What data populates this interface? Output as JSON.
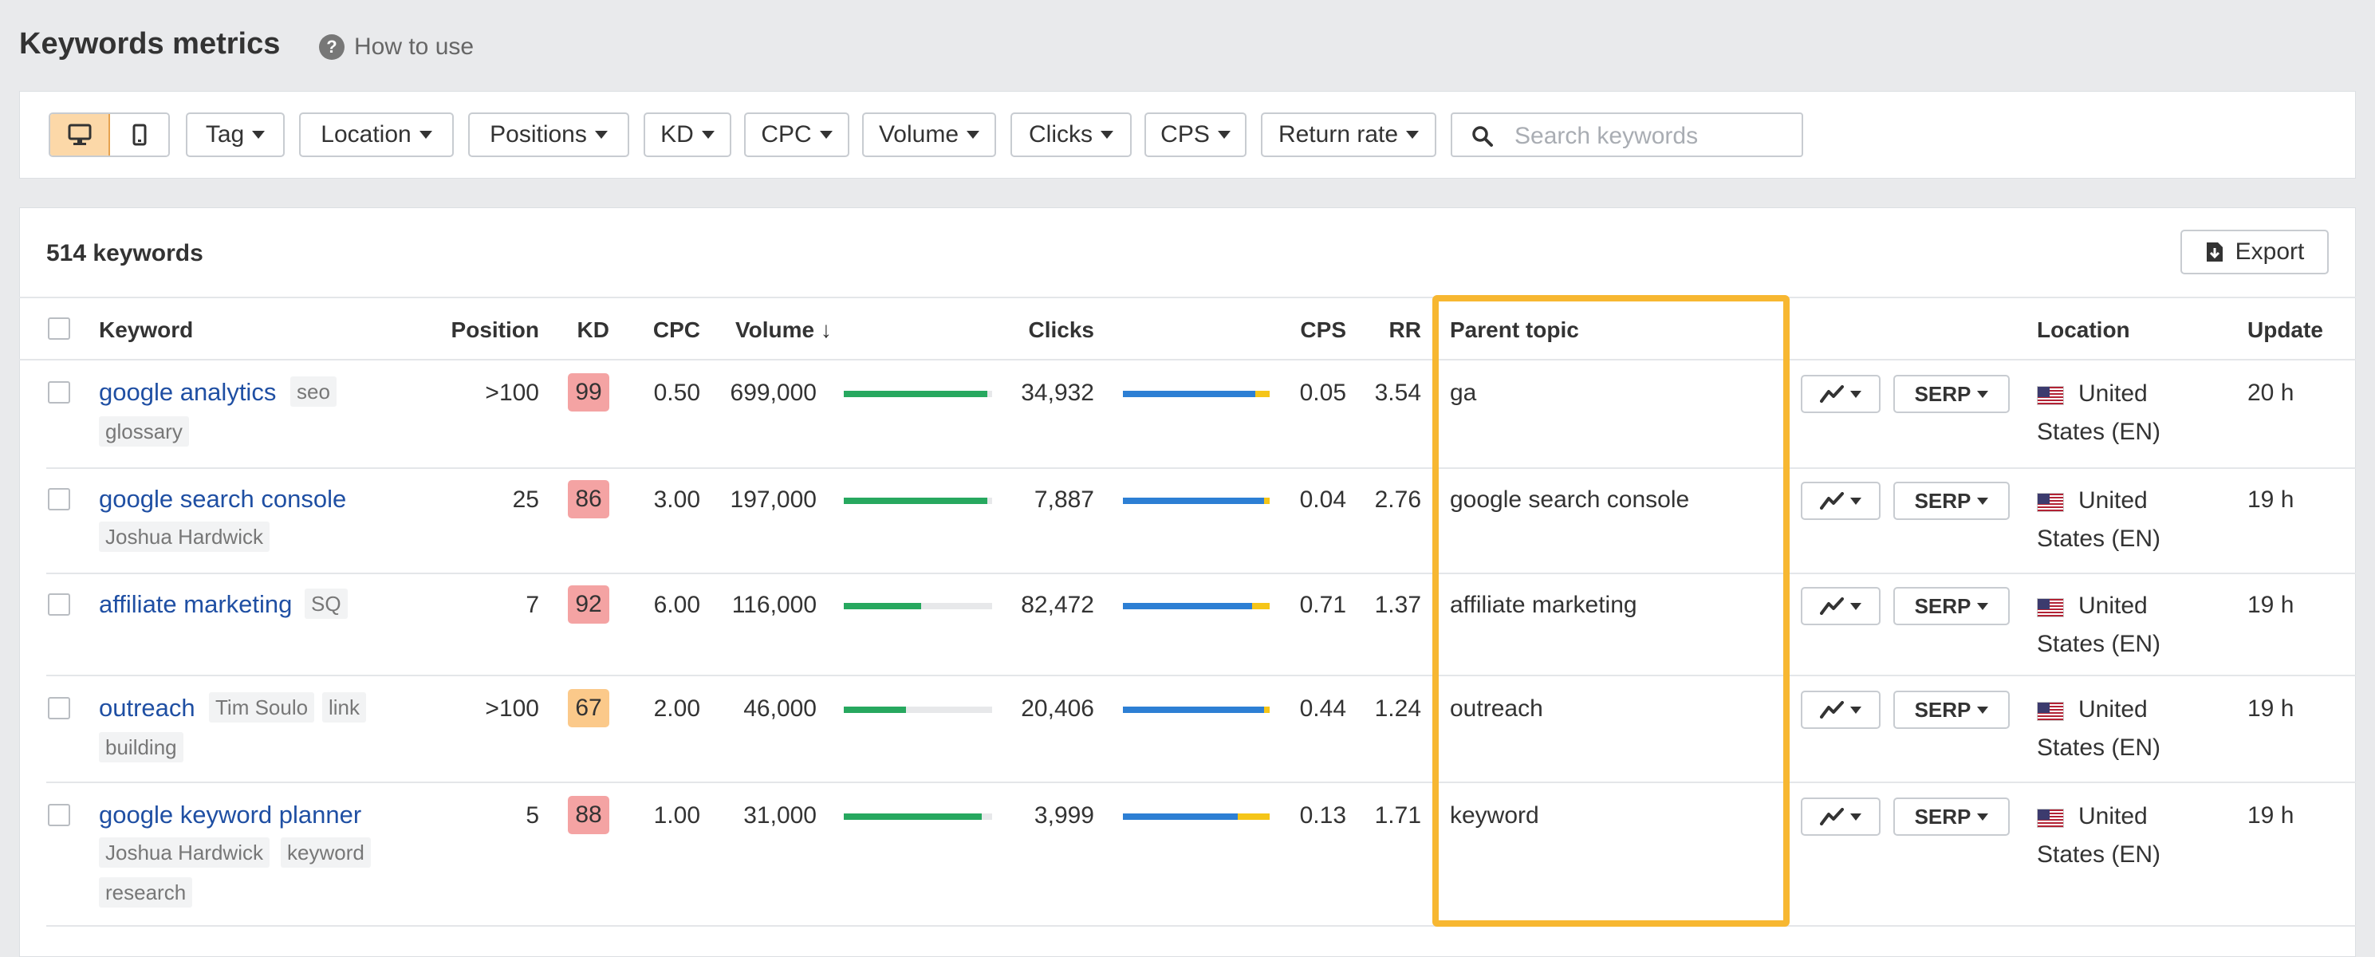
{
  "page_title": "Keywords metrics",
  "how_to_use": "How to use",
  "filters": {
    "tag": "Tag",
    "location": "Location",
    "positions": "Positions",
    "kd": "KD",
    "cpc": "CPC",
    "volume": "Volume",
    "clicks": "Clicks",
    "cps": "CPS",
    "return_rate": "Return rate",
    "search_placeholder": "Search keywords"
  },
  "summary": {
    "count_label": "514 keywords",
    "export_label": "Export"
  },
  "columns": {
    "keyword": "Keyword",
    "position": "Position",
    "kd": "KD",
    "cpc": "CPC",
    "volume": "Volume",
    "volume_sort": "↓",
    "clicks": "Clicks",
    "cps": "CPS",
    "rr": "RR",
    "parent_topic": "Parent topic",
    "location": "Location",
    "update": "Update"
  },
  "serp_label": "SERP",
  "colors": {
    "kd_red": "#f4a3a3",
    "kd_orange": "#fbc98a",
    "volume_green": "#27a85f",
    "clicks_blue": "#2d7fd4",
    "clicks_paid_yellow": "#f5c518",
    "highlight": "#f7b731",
    "link": "#1f4fa3"
  },
  "rows": [
    {
      "keyword": "google analytics",
      "tags": [
        "seo",
        "glossary"
      ],
      "position": ">100",
      "kd": "99",
      "cpc": "0.50",
      "volume": "699,000",
      "volume_fraction": 0.97,
      "clicks": "34,932",
      "clicks_paid_fraction": 0.1,
      "cps": "0.05",
      "rr": "3.54",
      "parent_topic": "ga",
      "location_line1": "United",
      "location_line2": "States (EN)",
      "update": "20 h"
    },
    {
      "keyword": "google search console",
      "tags": [
        "Joshua Hardwick"
      ],
      "position": "25",
      "kd": "86",
      "cpc": "3.00",
      "volume": "197,000",
      "volume_fraction": 0.97,
      "clicks": "7,887",
      "clicks_paid_fraction": 0.04,
      "cps": "0.04",
      "rr": "2.76",
      "parent_topic": "google search console",
      "location_line1": "United",
      "location_line2": "States (EN)",
      "update": "19 h"
    },
    {
      "keyword": "affiliate marketing",
      "tags": [
        "SQ"
      ],
      "position": "7",
      "kd": "92",
      "cpc": "6.00",
      "volume": "116,000",
      "volume_fraction": 0.52,
      "clicks": "82,472",
      "clicks_paid_fraction": 0.12,
      "cps": "0.71",
      "rr": "1.37",
      "parent_topic": "affiliate marketing",
      "location_line1": "United",
      "location_line2": "States (EN)",
      "update": "19 h"
    },
    {
      "keyword": "outreach",
      "tags": [
        "Tim Soulo",
        "link",
        "building"
      ],
      "position": ">100",
      "kd": "67",
      "cpc": "2.00",
      "volume": "46,000",
      "volume_fraction": 0.42,
      "clicks": "20,406",
      "clicks_paid_fraction": 0.04,
      "cps": "0.44",
      "rr": "1.24",
      "parent_topic": "outreach",
      "location_line1": "United",
      "location_line2": "States (EN)",
      "update": "19 h"
    },
    {
      "keyword": "google keyword planner",
      "tags": [
        "Joshua Hardwick",
        "keyword",
        "research"
      ],
      "position": "5",
      "kd": "88",
      "cpc": "1.00",
      "volume": "31,000",
      "volume_fraction": 0.93,
      "clicks": "3,999",
      "clicks_paid_fraction": 0.22,
      "cps": "0.13",
      "rr": "1.71",
      "parent_topic": "keyword",
      "location_line1": "United",
      "location_line2": "States (EN)",
      "update": "19 h"
    }
  ]
}
